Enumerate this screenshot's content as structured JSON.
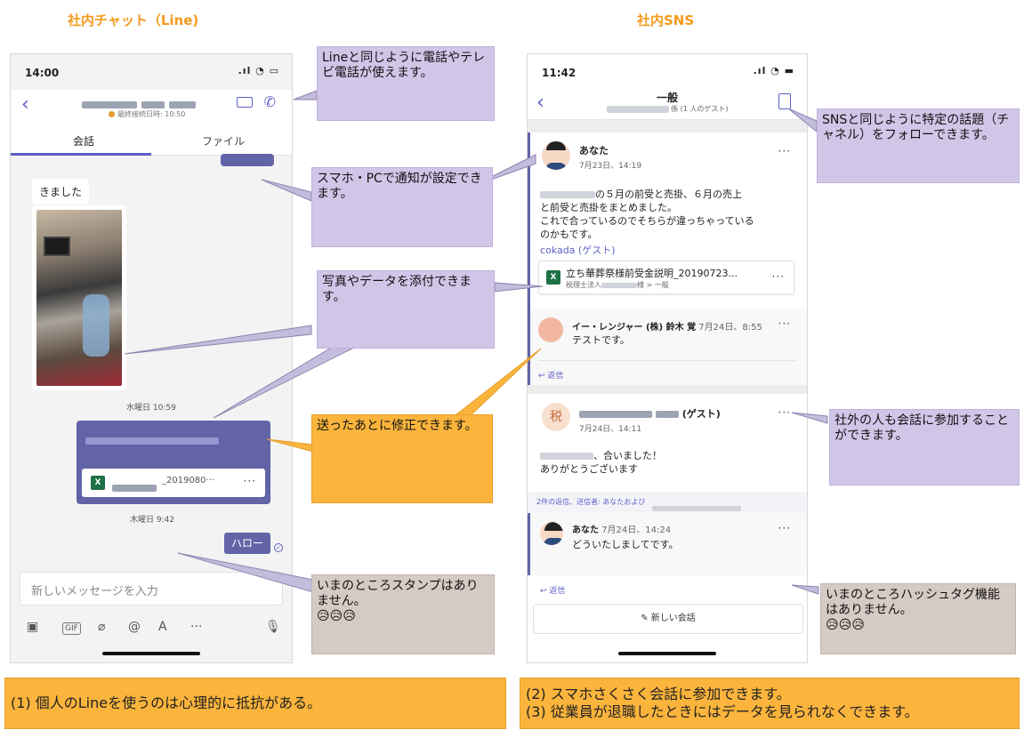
{
  "titles": {
    "left": "社内チャット（Line)",
    "right": "社内SNS"
  },
  "left_phone": {
    "time": "14:00",
    "signal": "📶",
    "last_login": "最終接続日時: 10:50",
    "tabs": [
      "会話",
      "ファイル"
    ],
    "message_in": "きました",
    "timestamp1": "水曜日 10:59",
    "attachment_name": "_2019080···",
    "timestamp2": "木曜日 9:42",
    "hello": "ハロー",
    "composer_placeholder": "新しいメッセージを入力",
    "toolbar_icons": [
      "image-icon",
      "gif-icon",
      "attach-icon",
      "mention-icon",
      "format-icon",
      "more-icon",
      "mic-icon"
    ]
  },
  "right_phone": {
    "time": "11:42",
    "channel_title": "一般",
    "channel_sub": "係 (1 人のゲスト)",
    "post1": {
      "author": "あなた",
      "date": "7月23日、14:19",
      "body_line1": "の５月の前受と売掛、６月の売上",
      "body_line2": "と前受と売掛をまとめました。",
      "body_line3": "これで合っているのでそちらが違っちゃっている",
      "body_line4": "のかもです。",
      "mention": "cokada (ゲスト)",
      "file_name": "立ち華葬祭様前受金説明_20190723...",
      "file_path_prefix": "税理士法人",
      "file_path_suffix": "様 > 一般"
    },
    "reply1": {
      "author": "イー・レンジャー (株) 鈴木 覚",
      "date": "7月24日、8:55",
      "body": "テストです。"
    },
    "reply_label": "返信",
    "post2": {
      "avatar": "税",
      "author_suffix": "(ゲスト)",
      "date": "7月24日、14:11",
      "body_line1": "、合いました！",
      "body_line2": "ありがとうございます",
      "replies_info": "2件の返信、送信者: あなたおよび"
    },
    "reply2": {
      "author": "あなた",
      "date": "7月24日、14:24",
      "body": "どういたしましてです。"
    },
    "new_conversation": "新しい会話"
  },
  "callouts": {
    "c1": "Lineと同じように電話やテレビ電話が使えます。",
    "c2": "スマホ・PCで通知が設定できます。",
    "c3": "写真やデータを添付できます。",
    "c4": "送ったあとに修正できます。",
    "c5": "いまのところスタンプはありません。",
    "c6": "SNSと同じように特定の話題（チャネル）をフォローできます。",
    "c7": "社外の人も会話に参加することができます。",
    "c8": "いまのところハッシュタグ機能はありません。",
    "sad_faces": "😥😥😥"
  },
  "footer": {
    "left": "(1) 個人のLineを使うのは心理的に抵抗がある。",
    "right1": "(2) スマホさくさく会話に参加できます。",
    "right2": "(3) 従業員が退職したときにはデータを見られなくできます。"
  }
}
